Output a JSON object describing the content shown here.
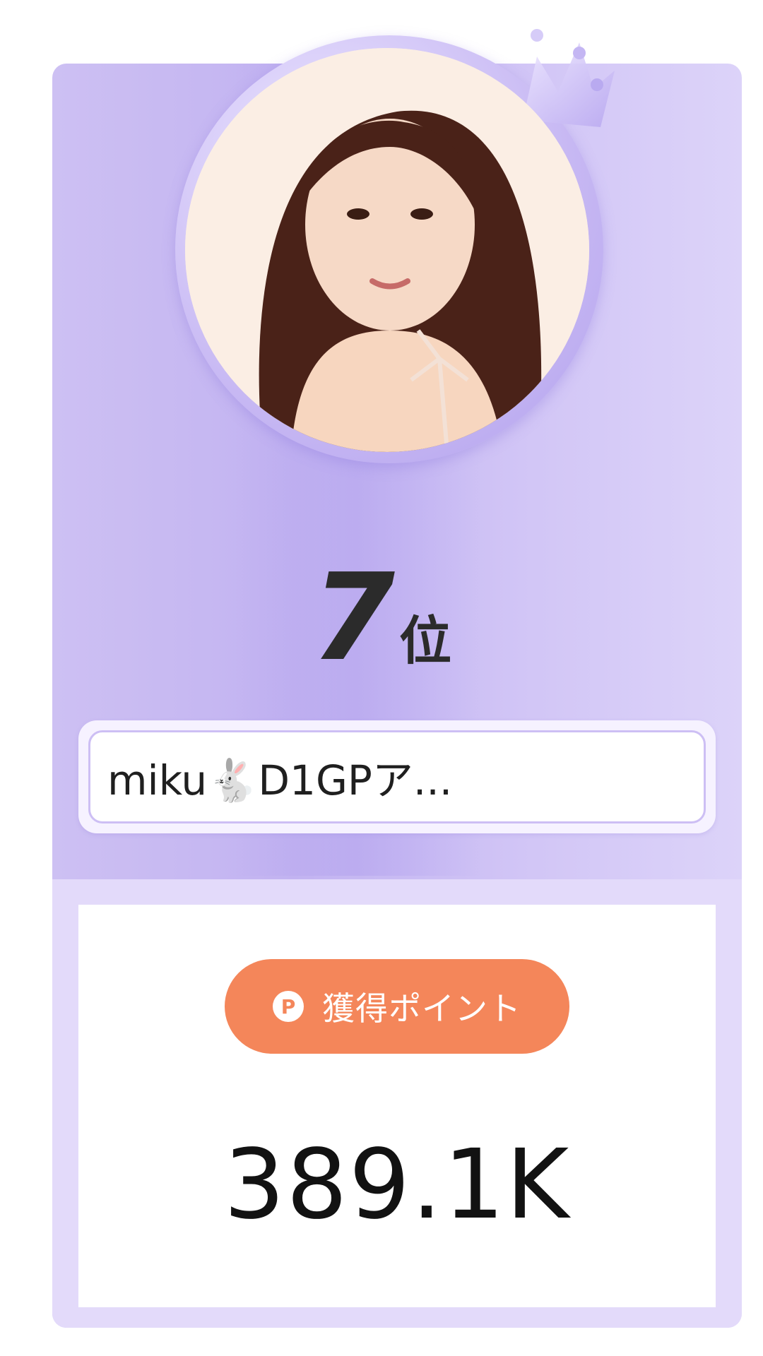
{
  "ranking_card": {
    "rank_number": "7",
    "rank_unit": "位",
    "user_name": "miku🐇D1GPア...",
    "points_label": "獲得ポイント",
    "points_icon": "p-coin-icon",
    "points_value": "389.1K"
  },
  "colors": {
    "card_background": "#c2b3f1",
    "badge_orange": "#f4865a",
    "text_dark": "#2b2b2b"
  }
}
